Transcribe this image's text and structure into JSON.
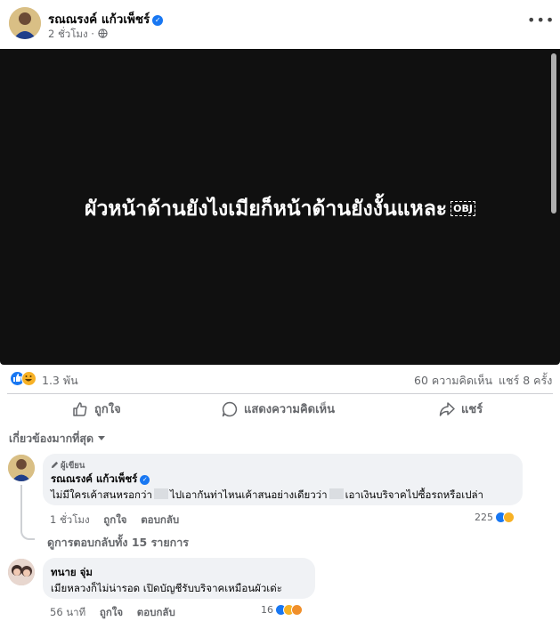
{
  "post": {
    "author": "รณณรงค์ แก้วเพ็ชร์",
    "time": "2 ชั่วโมง",
    "more_label": "•••",
    "media_text": "ผัวหน้าด้านยังไงเมียก็หน้าด้านยังงั้นแหละ",
    "media_obj": "OBJ"
  },
  "stats": {
    "reactions": "1.3 พัน",
    "comments": "60 ความคิดเห็น",
    "shares": "แชร์ 8 ครั้ง"
  },
  "actions": {
    "like": "ถูกใจ",
    "comment": "แสดงความคิดเห็น",
    "share": "แชร์"
  },
  "filter": {
    "label": "เกี่ยวข้องมากที่สุด"
  },
  "comments": [
    {
      "badge": "ผู้เขียน",
      "name": "รณณรงค์ แก้วเพ็ชร์",
      "text_part1": "ไม่มีใครเค้าสนหรอกว่า",
      "text_part2": "ไปเอากันท่าไหนเค้าสนอย่างเดียวว่า",
      "text_part3": "เอาเงินบริจาคไปซื้อรถหรือเปล่า",
      "time": "1 ชั่วโมง",
      "like": "ถูกใจ",
      "reply": "ตอบกลับ",
      "reaction_count": "225"
    },
    {
      "name": "ทนาย จุ่ม",
      "text": "เมียหลวงก็ไม่น่ารอด เปิดบัญชีรับบริจาคเหมือนผัวเด่ะ",
      "time": "56 นาที",
      "like": "ถูกใจ",
      "reply": "ตอบกลับ",
      "reaction_count": "16"
    }
  ],
  "view_replies": "ดูการตอบกลับทั้ง 15 รายการ",
  "colors": {
    "brand_blue": "#1877f2",
    "haha_yellow": "#f7b125",
    "muted_text": "#65676b",
    "bubble_bg": "#f0f2f5",
    "media_bg": "#101010"
  },
  "icons": [
    "more-icon",
    "globe-icon",
    "like-icon",
    "comment-icon",
    "share-icon",
    "verified-icon",
    "pencil-icon",
    "caret-down-icon"
  ]
}
